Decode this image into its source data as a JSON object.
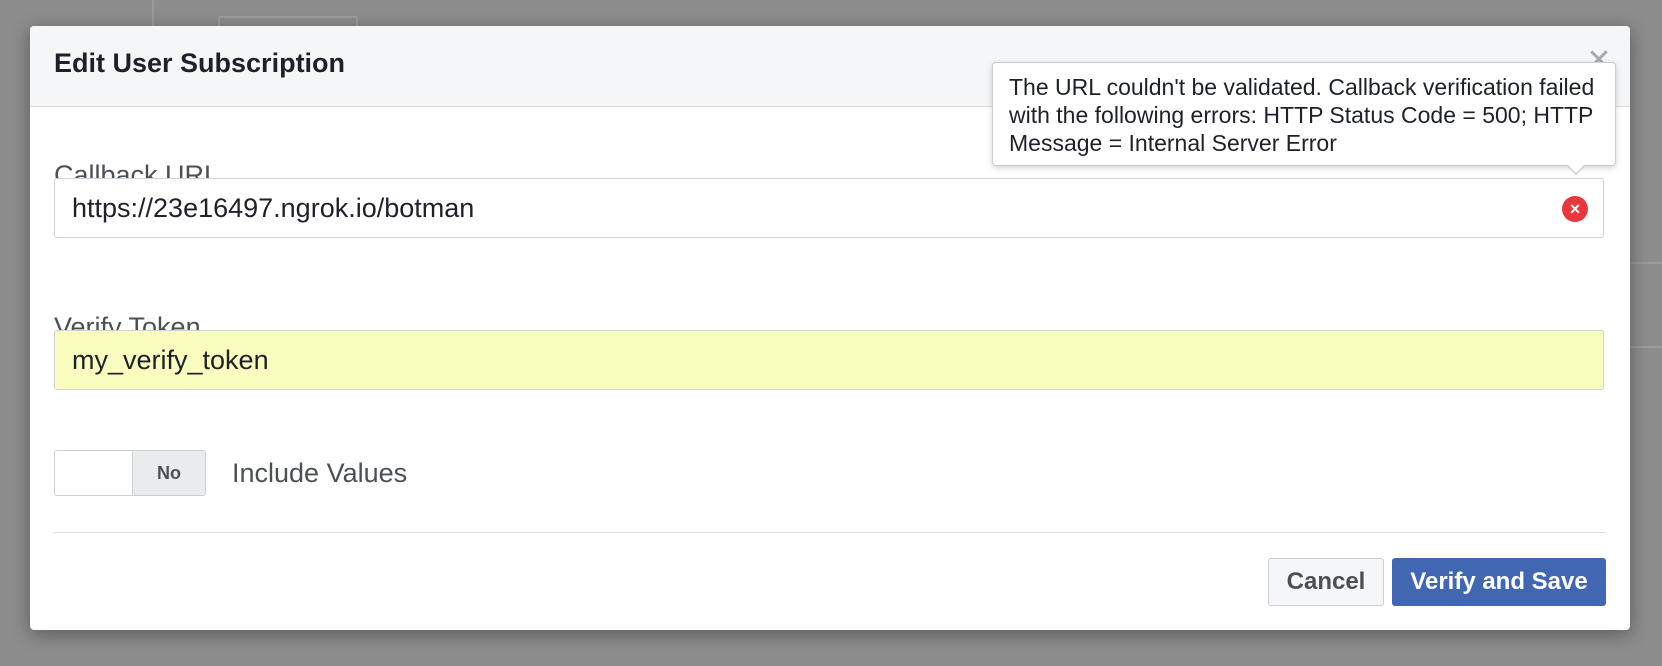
{
  "dialog": {
    "title": "Edit User Subscription",
    "close_glyph": "✕"
  },
  "callback_url": {
    "label": "Callback URL",
    "value": "https://23e16497.ngrok.io/botman",
    "error_glyph": "×"
  },
  "tooltip": {
    "message": "The URL couldn't be validated. Callback verification failed with the following errors: HTTP Status Code = 500; HTTP Message = Internal Server Error"
  },
  "verify_token": {
    "label": "Verify Token",
    "value": "my_verify_token",
    "highlight_color": "#f9fdbd"
  },
  "include_values": {
    "state_label": "No",
    "label": "Include Values"
  },
  "actions": {
    "cancel_label": "Cancel",
    "save_label": "Verify and Save",
    "save_color": "#4267b2"
  },
  "colors": {
    "error": "#e9373d",
    "overlay": "#8c8c8c"
  }
}
